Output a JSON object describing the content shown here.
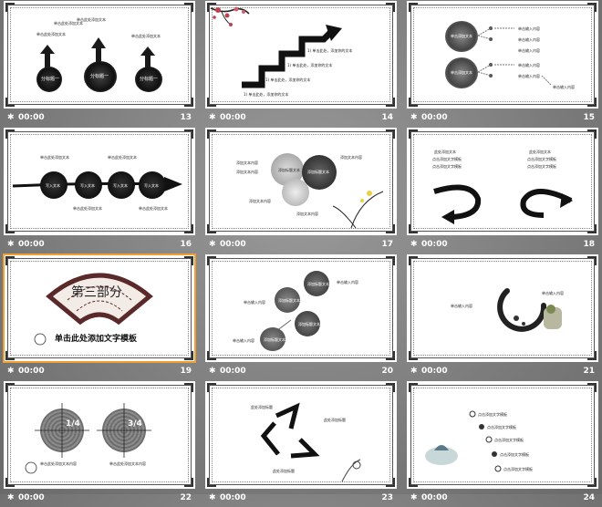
{
  "slides": [
    {
      "number": "13",
      "time": "00:00",
      "title": "",
      "texts": {
        "a": "单击此处添加文本",
        "b": "单击此处添加文本",
        "c": "单击此处添加文本",
        "d": "单击此处添加文本",
        "e": "分标题一",
        "f": "分标题一",
        "g": "分标题一"
      }
    },
    {
      "number": "14",
      "time": "00:00",
      "years": [
        "2011",
        "2012",
        "2013",
        "2014"
      ],
      "texts": {
        "a": "1) 单击此处，添加你的文本",
        "b": "1) 单击此处，添加你的文本",
        "c": "1) 单击此处，添加你的文本",
        "d": "1) 单击此处，添加你的文本"
      }
    },
    {
      "number": "15",
      "time": "00:00",
      "texts": {
        "a": "单击添加文本",
        "b": "单击添加文本",
        "l1": "单击输入内容",
        "l2": "单击输入内容",
        "l3": "单击输入内容",
        "l4": "单击输入内容",
        "l5": "单击输入内容",
        "l6": "单击输入内容"
      }
    },
    {
      "number": "16",
      "time": "00:00",
      "texts": {
        "a": "写入文本",
        "b": "写入文本",
        "c": "写入文本",
        "d": "写入文本",
        "t1": "单击此处添加文本",
        "t2": "单击此处添加文本",
        "t3": "单击此处添加文本",
        "t4": "单击此处添加文本"
      }
    },
    {
      "number": "17",
      "time": "00:00",
      "texts": {
        "a": "添加标题文本",
        "b": "添加标题文本",
        "l1": "添加文本内容",
        "l2": "添加文本内容",
        "l3": "添加文本内容",
        "l4": "添加文本内容",
        "l5": "添加文本内容"
      }
    },
    {
      "number": "18",
      "time": "00:00",
      "texts": {
        "h1": "此处添加文本",
        "h2": "此处添加文本",
        "a1": "点击添加文字模板",
        "a2": "点击添加文字模板",
        "b1": "点击添加文字模板",
        "b2": "点击添加文字模板"
      }
    },
    {
      "number": "19",
      "time": "00:00",
      "texts": {
        "title": "第三部分",
        "sub": "单击此处添加文字模板"
      }
    },
    {
      "number": "20",
      "time": "00:00",
      "texts": {
        "c1": "添加标题文本",
        "c2": "添加标题文本",
        "c3": "添加标题文本",
        "c4": "添加标题文本",
        "l1": "单击输入内容",
        "l2": "单击输入内容",
        "l3": "单击输入内容"
      }
    },
    {
      "number": "21",
      "time": "00:00",
      "texts": {
        "l1": "单击输入内容",
        "l2": "单击输入内容"
      }
    },
    {
      "number": "22",
      "time": "00:00",
      "texts": {
        "p1": "1/4",
        "p2": "3/4",
        "a": "单击此处添加文本内容",
        "b": "单击此处添加文本内容"
      }
    },
    {
      "number": "23",
      "time": "00:00",
      "texts": {
        "a": "此处添加标题",
        "b": "此处添加标题",
        "c": "此处添加标题"
      }
    },
    {
      "number": "24",
      "time": "00:00",
      "texts": {
        "a": "点击添加文字模板",
        "b": "点击添加文字模板",
        "c": "点击添加文字模板",
        "d": "点击添加文字模板",
        "e": "点击添加文字模板"
      }
    }
  ],
  "colors": {
    "ink": "#1a1a1a",
    "plum": "#c04050",
    "selection": "#f0a030"
  }
}
